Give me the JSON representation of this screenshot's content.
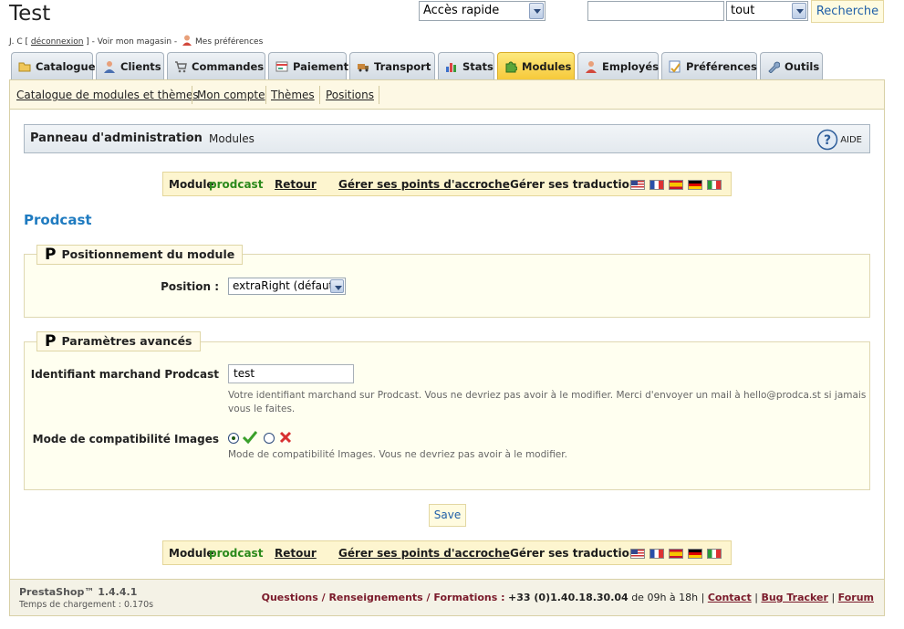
{
  "header": {
    "title": "Test",
    "user_name": "J. C",
    "logout_label": "déconnexion",
    "view_shop_label": "Voir mon magasin",
    "preferences_label": "Mes préférences",
    "quick_access_value": "Accès rapide",
    "search_value": "",
    "search_scope_value": "tout",
    "search_button_label": "Recherche"
  },
  "tabs": [
    {
      "label": "Catalogue",
      "icon": "folder-icon",
      "active": false
    },
    {
      "label": "Clients",
      "icon": "customers-icon",
      "active": false
    },
    {
      "label": "Commandes",
      "icon": "cart-icon",
      "active": false
    },
    {
      "label": "Paiement",
      "icon": "payment-icon",
      "active": false
    },
    {
      "label": "Transport",
      "icon": "truck-icon",
      "active": false
    },
    {
      "label": "Stats",
      "icon": "stats-icon",
      "active": false
    },
    {
      "label": "Modules",
      "icon": "puzzle-icon",
      "active": true
    },
    {
      "label": "Employés",
      "icon": "employee-icon",
      "active": false
    },
    {
      "label": "Préférences",
      "icon": "preferences-icon",
      "active": false
    },
    {
      "label": "Outils",
      "icon": "wrench-icon",
      "active": false
    }
  ],
  "subnav": [
    {
      "label": "Catalogue de modules et thèmes"
    },
    {
      "label": "Mon compte"
    },
    {
      "label": "Thèmes"
    },
    {
      "label": "Positions"
    }
  ],
  "breadcrumb": {
    "home": "Panneau d'administration",
    "separator": "›",
    "current": "Modules",
    "help_label": "AIDE"
  },
  "module_bar": {
    "prefix": "Module",
    "module_name": "prodcast",
    "back_label": "Retour",
    "hooks_label": "Gérer ses points d'accroche",
    "translations_label": "Gérer ses traductions",
    "flags": [
      "flag-us-icon",
      "flag-fr-icon",
      "flag-es-icon",
      "flag-de-icon",
      "flag-it-icon"
    ]
  },
  "page_title": "Prodcast",
  "positioning": {
    "legend": "Positionnement du module",
    "legend_icon": "P",
    "position_label": "Position :",
    "position_value": "extraRight (défaut)"
  },
  "advanced": {
    "legend": "Paramètres avancés",
    "legend_icon": "P",
    "merchant_label": "Identifiant marchand Prodcast",
    "merchant_value": "test",
    "merchant_help": "Votre identifiant marchand sur Prodcast. Vous ne devriez pas avoir à le modifier. Merci d'envoyer un mail à hello@prodca.st si jamais vous le faites.",
    "compat_label": "Mode de compatibilité Images",
    "compat_enabled": true,
    "compat_help": "Mode de compatibilité Images. Vous ne devriez pas avoir à le modifier."
  },
  "save_label": "Save",
  "footer": {
    "version": "PrestaShop™ 1.4.4.1",
    "load_time": "Temps de chargement : 0.170s",
    "questions_label": "Questions / Renseignements / Formations :",
    "phone": "+33 (0)1.40.18.30.04",
    "hours": "de 09h à 18h",
    "contact_label": "Contact",
    "bugtracker_label": "Bug Tracker",
    "forum_label": "Forum"
  },
  "colors": {
    "active_tab": "#f6c93a",
    "title_blue": "#1f7bc0",
    "module_green": "#2c8a1c",
    "footer_red": "#7a1a2a"
  }
}
